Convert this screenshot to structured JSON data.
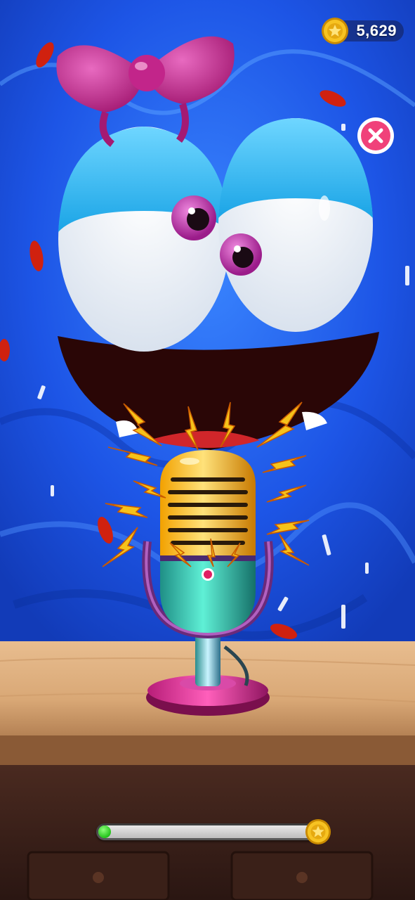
{
  "hud": {
    "coin_count": "5,629",
    "coin_icon": "coin-icon",
    "close_icon": "close-icon"
  },
  "progress": {
    "level": 0.04,
    "end_icon": "coin-icon"
  },
  "scene": {
    "character": "blue-blob-character",
    "prop": "microphone",
    "decorations": [
      "bow-icon",
      "lips-icon",
      "lightning-icon"
    ]
  },
  "colors": {
    "background": "#1e5fe8",
    "accent_pink": "#d8307a",
    "coin_gold": "#f4b818",
    "progress_green": "#23c21a",
    "table_wood": "#d6a574"
  }
}
